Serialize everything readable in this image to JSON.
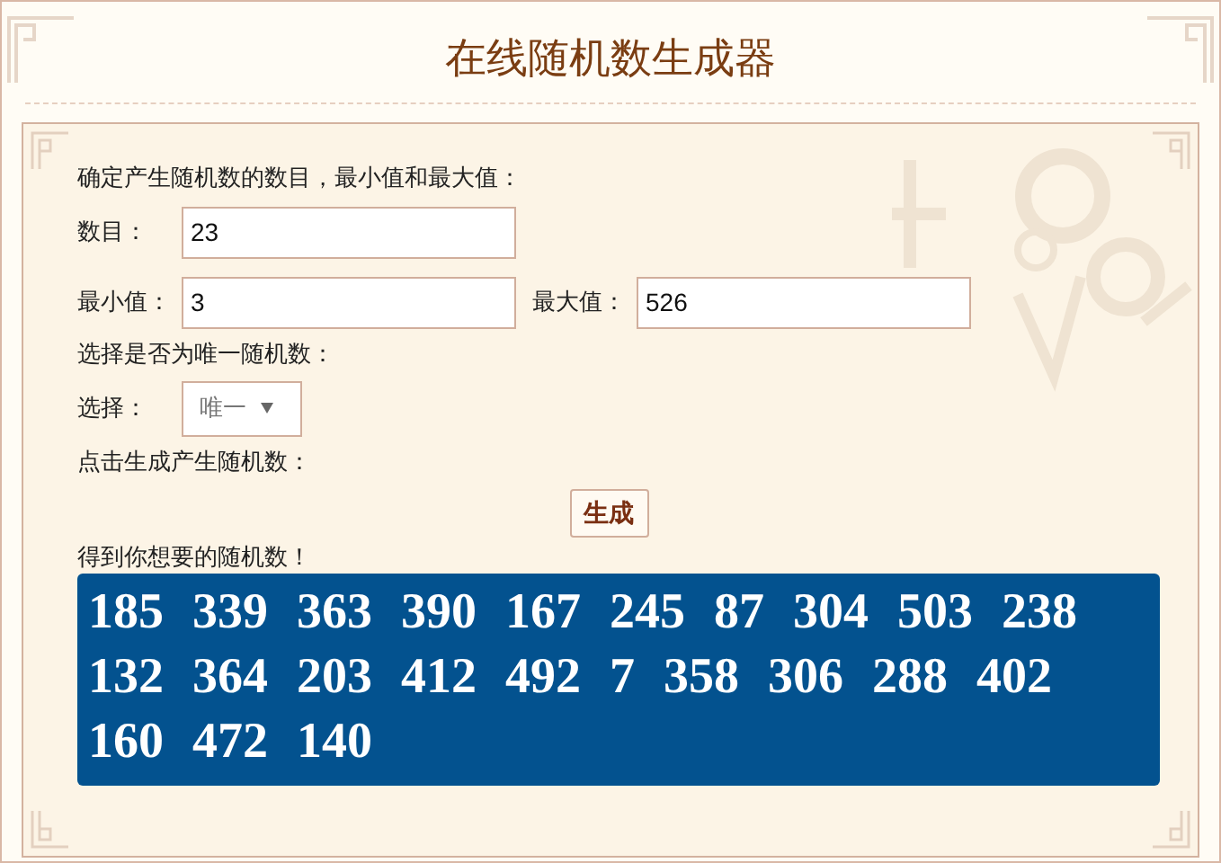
{
  "title": "在线随机数生成器",
  "intro": "确定产生随机数的数目，最小值和最大值：",
  "count_field": {
    "label": "数目：",
    "value": "23"
  },
  "min_field": {
    "label": "最小值：",
    "value": "3"
  },
  "max_field": {
    "label": "最大值：",
    "value": "526"
  },
  "unique_prompt": "选择是否为唯一随机数：",
  "unique_select": {
    "label": "选择：",
    "value": "唯一"
  },
  "generate_prompt": "点击生成产生随机数：",
  "generate_button": "生成",
  "result_label": "得到你想要的随机数！",
  "results": [
    "185",
    "339",
    "363",
    "390",
    "167",
    "245",
    "87",
    "304",
    "503",
    "238",
    "132",
    "364",
    "203",
    "412",
    "492",
    "7",
    "358",
    "306",
    "288",
    "402",
    "160",
    "472",
    "140"
  ]
}
